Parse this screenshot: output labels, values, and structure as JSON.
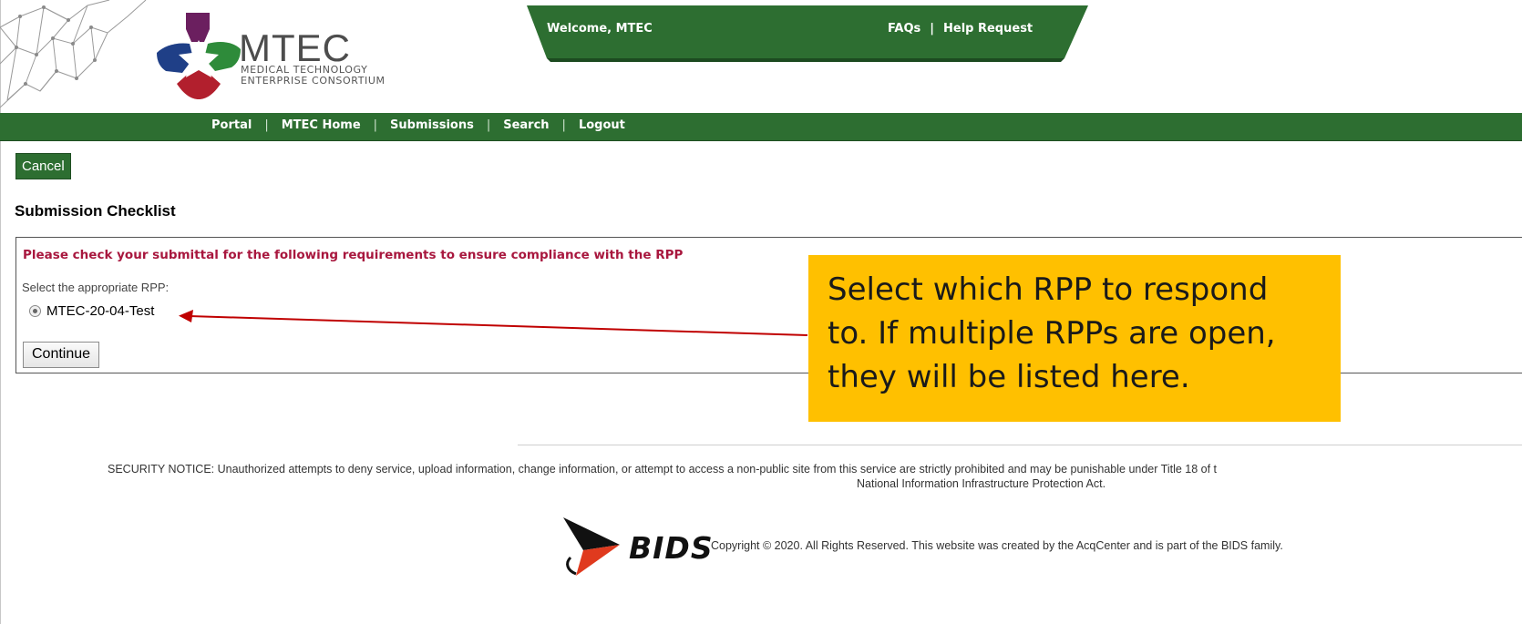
{
  "header": {
    "brand_name": "MTEC",
    "brand_subtitle_line1": "MEDICAL TECHNOLOGY",
    "brand_subtitle_line2": "ENTERPRISE CONSORTIUM",
    "welcome": "Welcome, MTEC",
    "top_links": [
      "FAQs",
      "Help Request"
    ],
    "top_links_separator": "|"
  },
  "nav": {
    "items": [
      "Portal",
      "MTEC Home",
      "Submissions",
      "Search",
      "Logout"
    ],
    "separator": "|"
  },
  "main": {
    "cancel_label": "Cancel",
    "title": "Submission Checklist",
    "panel_heading": "Please check your submittal for the following requirements to ensure compliance with the RPP",
    "rpp_label": "Select the appropriate RPP:",
    "rpp_options": [
      {
        "label": "MTEC-20-04-Test",
        "selected": true
      }
    ],
    "continue_label": "Continue"
  },
  "callout": {
    "lines": [
      "Select which RPP to respond",
      "to. If multiple RPPs are open,",
      "they will be listed here."
    ]
  },
  "footer": {
    "security_line1": "SECURITY NOTICE: Unauthorized attempts to deny service, upload information, change information, or attempt to access a non-public site from this service are strictly prohibited and may be punishable under Title 18 of t",
    "security_line2": "National Information Infrastructure Protection Act.",
    "bids_logo_text": "BIDS",
    "copyright": "Copyright © 2020. All Rights Reserved. This website was created by the AcqCenter and is part of the BIDS family."
  },
  "colors": {
    "brand_green": "#2d6e31",
    "heading_red": "#a8173e",
    "callout_yellow": "#ffc000",
    "arrow_red": "#c00000"
  }
}
